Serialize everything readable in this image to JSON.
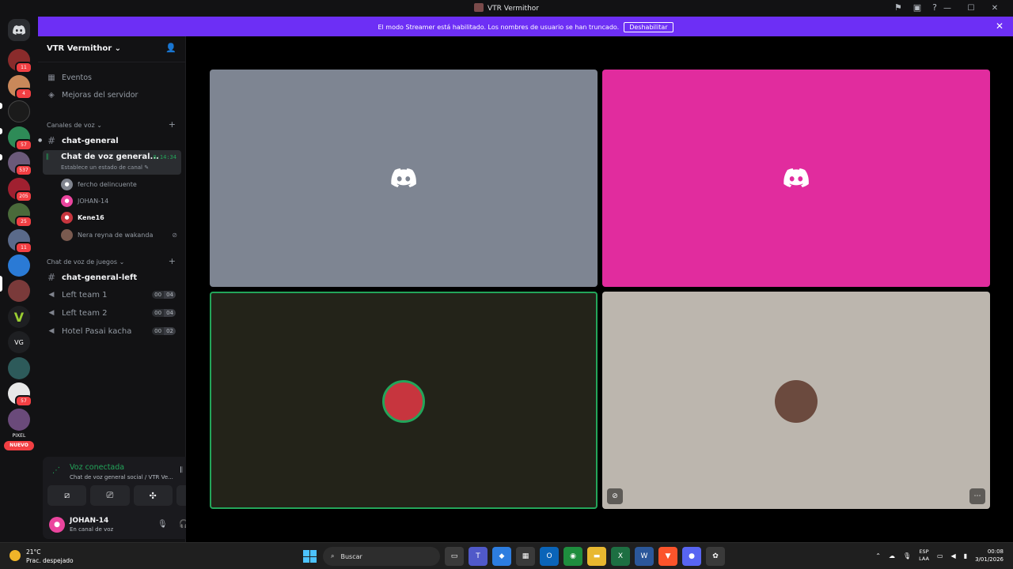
{
  "window": {
    "title": "VTR Vermithor"
  },
  "banner": {
    "message": "El modo Streamer está habilitado. Los nombres de usuario se han truncado.",
    "button_label": "Deshabilitar"
  },
  "guilds": {
    "badges": [
      "11",
      "4",
      "",
      "57",
      "537",
      "205",
      "25",
      "11",
      "",
      "",
      "",
      "",
      "57"
    ],
    "text_items": [
      "VG",
      "PIXEL"
    ],
    "new_label": "NUEVO"
  },
  "server": {
    "name": "VTR Vermithor ⌄",
    "items": [
      {
        "label": "Eventos",
        "icon": "calendar-icon"
      },
      {
        "label": "Mejoras del servidor",
        "icon": "boost-icon"
      }
    ],
    "category_voice": "Canales de voz ⌄",
    "category_games": "Chat de voz de juegos ⌄",
    "channels_top": [
      {
        "label": "chat-general"
      }
    ],
    "active_voice": {
      "label": "Chat de voz general...",
      "time": "8:14:34",
      "status": "Establece un estado de canal ✎"
    },
    "voice_users": [
      {
        "name": "fercho delincuente",
        "color": "#80848e"
      },
      {
        "name": "JOHAN-14",
        "color": "#eb459e"
      },
      {
        "name": "Kene16",
        "color": "#c7353e"
      },
      {
        "name": "Nera reyna de wakanda",
        "color": "#7a5a4f"
      }
    ],
    "channels_games": [
      {
        "label": "chat-general-left",
        "type": "text"
      },
      {
        "label": "Left team 1",
        "type": "voice",
        "count_a": "00",
        "count_b": "04"
      },
      {
        "label": "Left team 2",
        "type": "voice",
        "count_a": "00",
        "count_b": "04"
      },
      {
        "label": "Hotel Pasai kacha",
        "type": "voice",
        "count_a": "00",
        "count_b": "02"
      }
    ]
  },
  "voice_panel": {
    "status": "Voz conectada",
    "channel": "Chat de voz general social / VTR Ve..."
  },
  "user": {
    "name": "JOHAN-14",
    "status": "En canal de voz"
  },
  "stage": {
    "tiles": [
      {
        "bg": "#7e8592",
        "kind": "logo"
      },
      {
        "bg": "#e12c9e",
        "kind": "logo"
      },
      {
        "bg": "#232319",
        "kind": "avatar",
        "avatar_color": "#c7353e",
        "speaking": true
      },
      {
        "bg": "#bcb6ae",
        "kind": "avatar",
        "avatar_color": "#6b4a3e",
        "muted": true
      }
    ]
  },
  "taskbar": {
    "temperature": "21°C",
    "weather": "Prac. despejado",
    "search_label": "Buscar",
    "lang_top": "ESP",
    "lang_bottom": "LAA",
    "time": "00:08",
    "date": "3/01/2026"
  }
}
